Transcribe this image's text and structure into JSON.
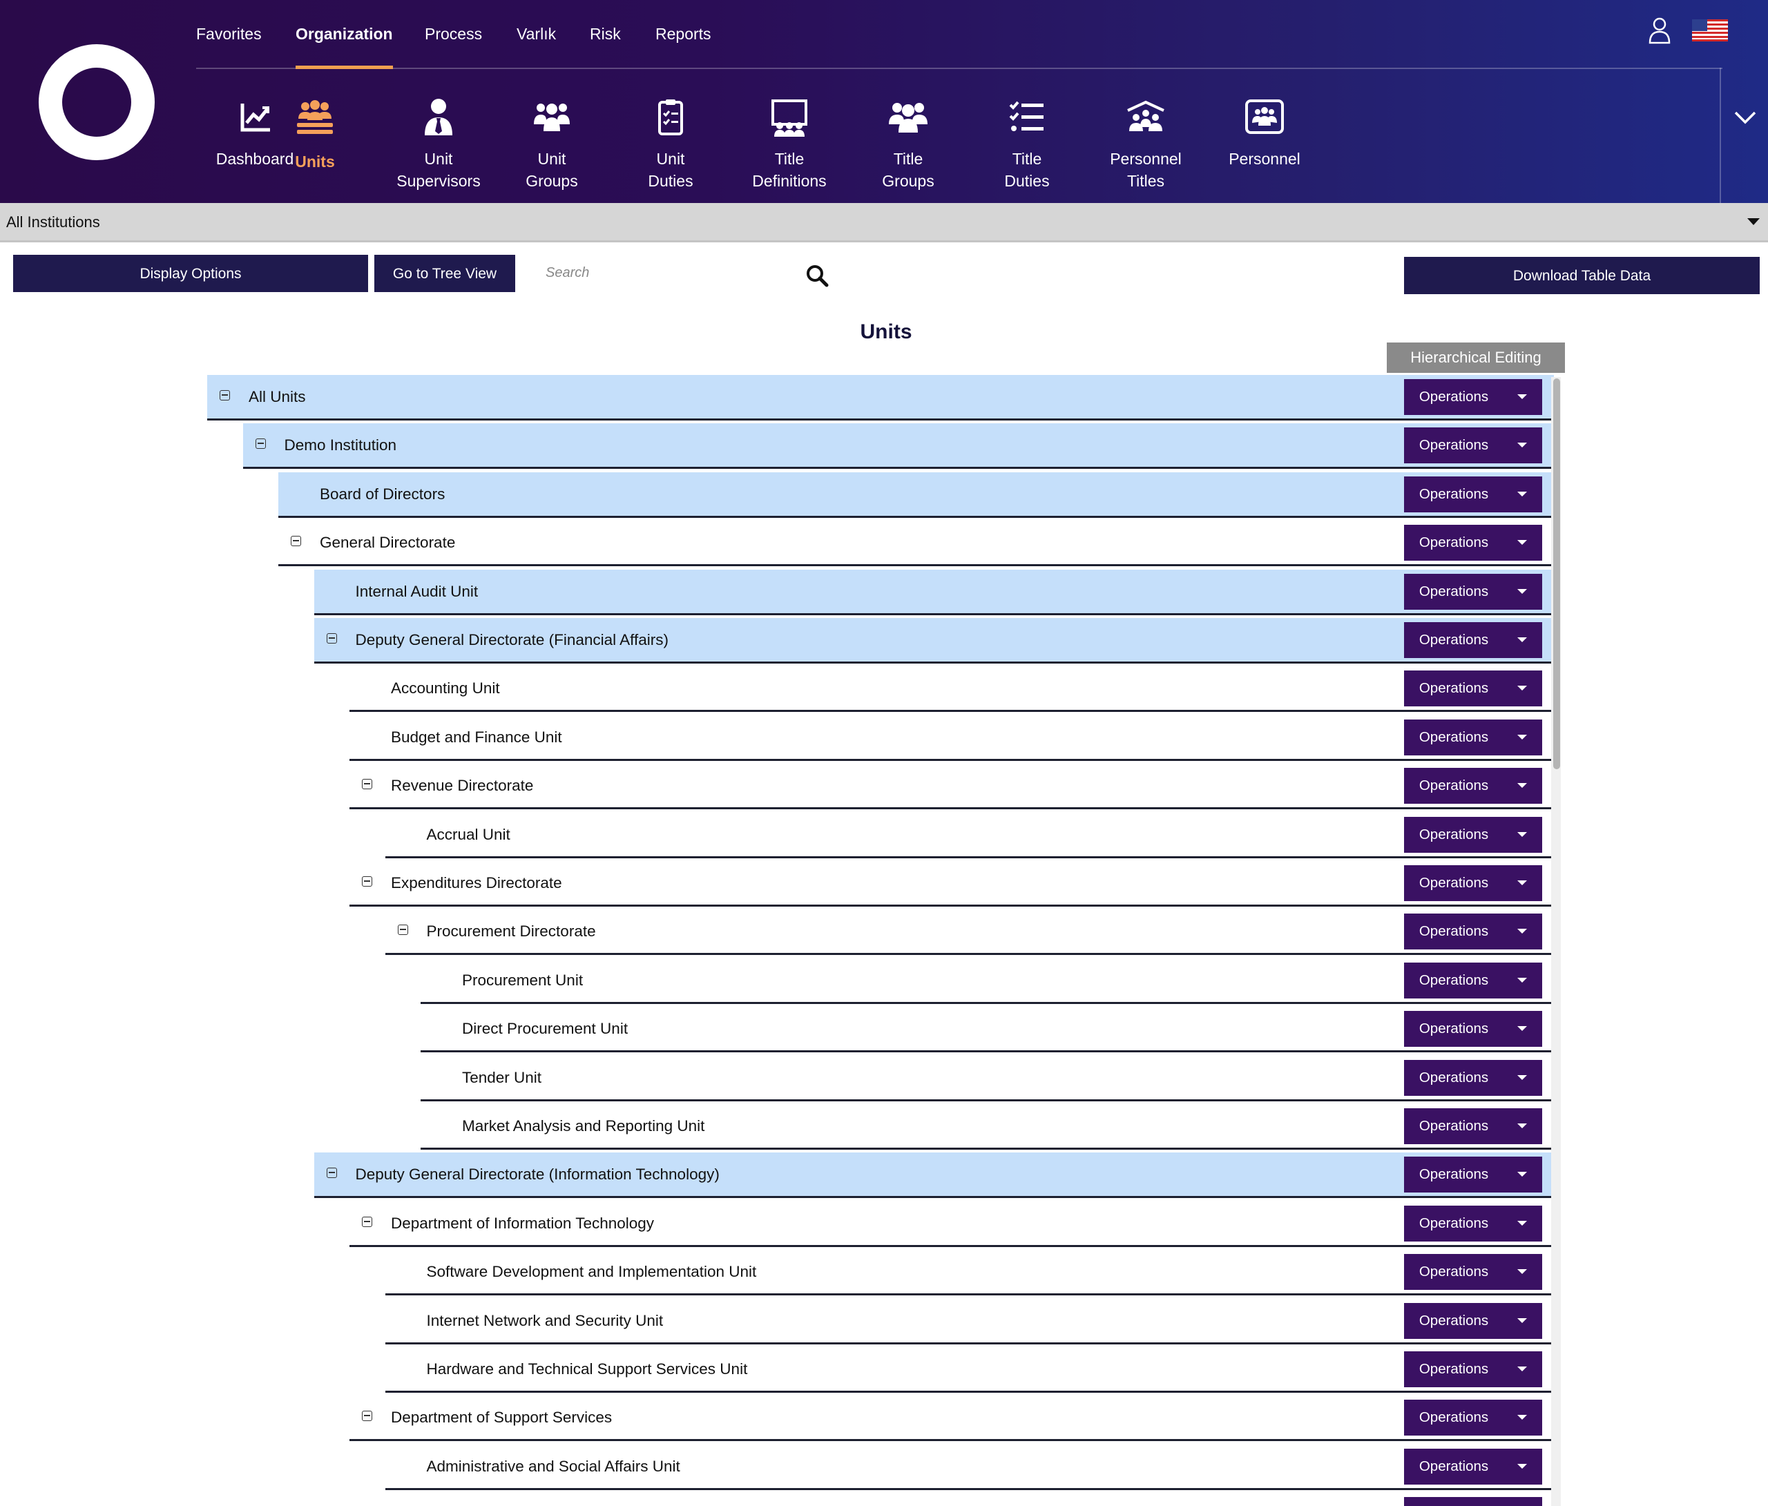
{
  "top_menu": [
    {
      "label": "Favorites",
      "active": false
    },
    {
      "label": "Organization",
      "active": true
    },
    {
      "label": "Process",
      "active": false
    },
    {
      "label": "Varlık",
      "active": false
    },
    {
      "label": "Risk",
      "active": false
    },
    {
      "label": "Reports",
      "active": false
    }
  ],
  "sub_nav": [
    {
      "label": "Dashboard",
      "icon": "chart-line-icon",
      "active": false
    },
    {
      "label": "Units",
      "icon": "users-group-icon",
      "active": true
    },
    {
      "label": "Unit\nSupervisors",
      "icon": "user-tie-icon",
      "active": false
    },
    {
      "label": "Unit\nGroups",
      "icon": "people-group-icon",
      "active": false
    },
    {
      "label": "Unit\nDuties",
      "icon": "clipboard-list-icon",
      "active": false
    },
    {
      "label": "Title\nDefinitions",
      "icon": "chalkboard-users-icon",
      "active": false
    },
    {
      "label": "Title\nGroups",
      "icon": "users-icon",
      "active": false
    },
    {
      "label": "Title\nDuties",
      "icon": "list-check-icon",
      "active": false
    },
    {
      "label": "Personnel\nTitles",
      "icon": "people-roof-icon",
      "active": false
    },
    {
      "label": "Personnel",
      "icon": "id-card-group-icon",
      "active": false
    }
  ],
  "institution": "All Institutions",
  "toolbar": {
    "display_options": "Display Options",
    "tree_view": "Go to Tree View",
    "search_placeholder": "Search",
    "download": "Download Table Data"
  },
  "page_title": "Units",
  "hierarchical_editing": "Hierarchical Editing",
  "operations_label": "Operations",
  "units": [
    {
      "name": "All Units",
      "level": 0,
      "toggle": true,
      "highlight": true
    },
    {
      "name": "Demo Institution",
      "level": 1,
      "toggle": true,
      "highlight": true
    },
    {
      "name": "Board of Directors",
      "level": 2,
      "toggle": false,
      "highlight": true
    },
    {
      "name": "General Directorate",
      "level": 2,
      "toggle": true,
      "highlight": false
    },
    {
      "name": "Internal Audit Unit",
      "level": 3,
      "toggle": false,
      "highlight": true
    },
    {
      "name": "Deputy General Directorate (Financial Affairs)",
      "level": 3,
      "toggle": true,
      "highlight": true
    },
    {
      "name": "Accounting Unit",
      "level": 4,
      "toggle": false,
      "highlight": false
    },
    {
      "name": "Budget and Finance Unit",
      "level": 4,
      "toggle": false,
      "highlight": false
    },
    {
      "name": "Revenue Directorate",
      "level": 4,
      "toggle": true,
      "highlight": false
    },
    {
      "name": "Accrual Unit",
      "level": 5,
      "toggle": false,
      "highlight": false
    },
    {
      "name": "Expenditures Directorate",
      "level": 4,
      "toggle": true,
      "highlight": false
    },
    {
      "name": "Procurement Directorate",
      "level": 5,
      "toggle": true,
      "highlight": false
    },
    {
      "name": "Procurement Unit",
      "level": 6,
      "toggle": false,
      "highlight": false
    },
    {
      "name": "Direct Procurement Unit",
      "level": 6,
      "toggle": false,
      "highlight": false
    },
    {
      "name": "Tender Unit",
      "level": 6,
      "toggle": false,
      "highlight": false
    },
    {
      "name": "Market Analysis and Reporting Unit",
      "level": 6,
      "toggle": false,
      "highlight": false
    },
    {
      "name": "Deputy General Directorate (Information Technology)",
      "level": 3,
      "toggle": true,
      "highlight": true
    },
    {
      "name": "Department of Information Technology",
      "level": 4,
      "toggle": true,
      "highlight": false
    },
    {
      "name": "Software Development and Implementation Unit",
      "level": 5,
      "toggle": false,
      "highlight": false
    },
    {
      "name": "Internet Network and Security Unit",
      "level": 5,
      "toggle": false,
      "highlight": false
    },
    {
      "name": "Hardware and Technical Support Services Unit",
      "level": 5,
      "toggle": false,
      "highlight": false
    },
    {
      "name": "Department of Support Services",
      "level": 4,
      "toggle": true,
      "highlight": false
    },
    {
      "name": "Administrative and Social Affairs Unit",
      "level": 5,
      "toggle": false,
      "highlight": false
    },
    {
      "name": "",
      "level": 5,
      "toggle": false,
      "highlight": false
    }
  ],
  "colors": {
    "header_dark": "#2a0a4a",
    "accent_orange": "#f5a05a",
    "button_navy": "#1f1a4e",
    "operations_purple": "#3a1163",
    "row_highlight": "#c5dffa"
  }
}
